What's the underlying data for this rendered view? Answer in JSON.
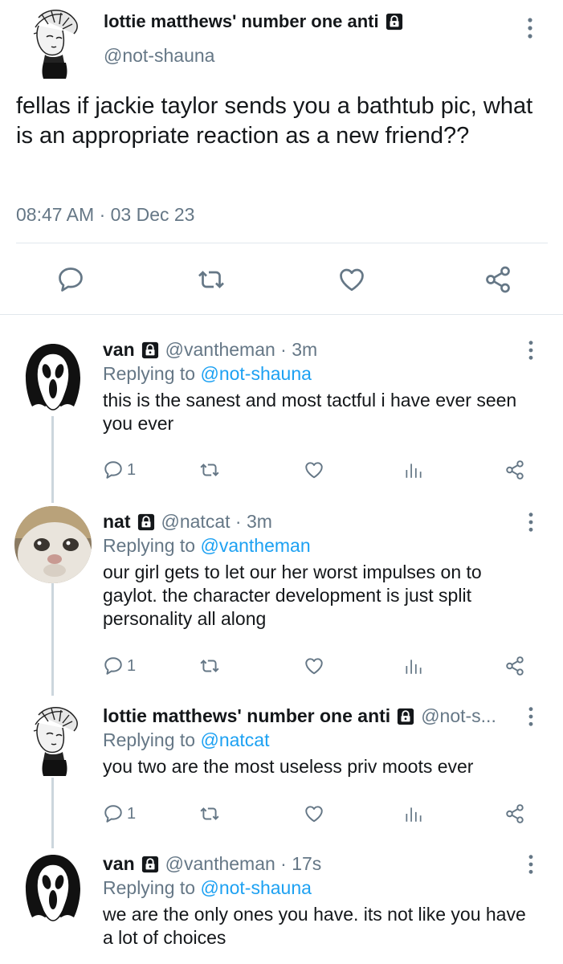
{
  "main_tweet": {
    "author_name": "lottie matthews' number one anti",
    "handle": "@not-shauna",
    "text": "fellas if jackie taylor sends you a bathtub pic, what is an appropriate reaction as a new friend??",
    "timestamp": "08:47 AM · 03 Dec 23",
    "icons": [
      "comment-icon",
      "retweet-icon",
      "heart-icon",
      "share-icon",
      "more-vertical-icon",
      "lock-icon"
    ]
  },
  "replies": [
    {
      "author_name": "van",
      "handle_time": "@vantheman · 3m",
      "replying_prefix": "Replying to ",
      "replying_to": "@not-shauna",
      "text": "this is the sanest and most tactful i have ever seen you ever",
      "reply_count": "1",
      "avatar": "ghostface"
    },
    {
      "author_name": "nat",
      "handle_time": "@natcat · 3m",
      "replying_prefix": "Replying to ",
      "replying_to": "@vantheman",
      "text": "our girl gets to let our her worst impulses on to gaylot. the character development is just split personality all along",
      "reply_count": "1",
      "avatar": "cat"
    },
    {
      "author_name": "lottie matthews' number one anti",
      "handle_time": "@not-s...",
      "replying_prefix": "Replying to ",
      "replying_to": "@natcat",
      "text": "you two are the most useless priv moots ever",
      "reply_count": "1",
      "avatar": "sketch"
    },
    {
      "author_name": "van",
      "handle_time": "@vantheman · 17s",
      "replying_prefix": "Replying to ",
      "replying_to": "@not-shauna",
      "text": "we are the only ones you have. its not like you have a lot of choices",
      "avatar": "ghostface"
    }
  ],
  "colors": {
    "text": "#14171a",
    "secondary": "#657786",
    "link": "#1da1f2",
    "divider": "#e1e8ed",
    "thread_line": "#ccd6dd"
  }
}
